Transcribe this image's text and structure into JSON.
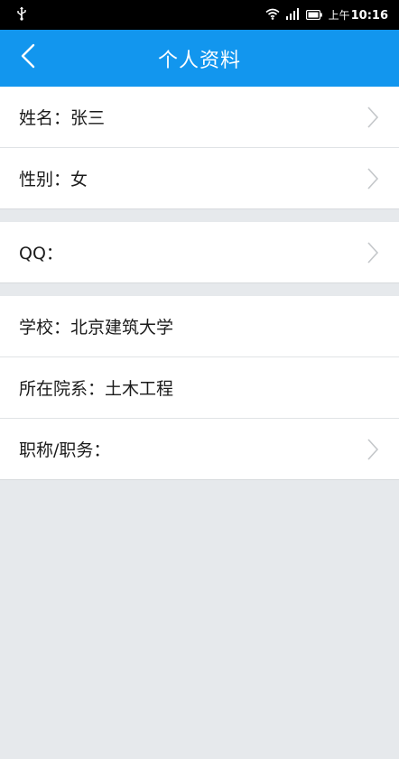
{
  "status_bar": {
    "ampm": "上午",
    "time": "10:16",
    "icons": [
      "usb-icon",
      "wifi-icon",
      "signal-icon",
      "battery-icon"
    ]
  },
  "header": {
    "title": "个人资料",
    "back_icon": "back-chevron-icon"
  },
  "groups": [
    {
      "rows": [
        {
          "label": "姓名：张三",
          "chevron": true
        },
        {
          "label": "性别：女",
          "chevron": true
        }
      ]
    },
    {
      "rows": [
        {
          "label": "QQ：",
          "chevron": true
        }
      ]
    },
    {
      "rows": [
        {
          "label": "学校：北京建筑大学",
          "chevron": false
        },
        {
          "label": "所在院系：土木工程",
          "chevron": false
        },
        {
          "label": "职称/职务：",
          "chevron": true
        }
      ]
    }
  ],
  "colors": {
    "header_bg": "#1296ee",
    "page_bg": "#e6e9ec",
    "chevron": "#c4c7ca"
  }
}
